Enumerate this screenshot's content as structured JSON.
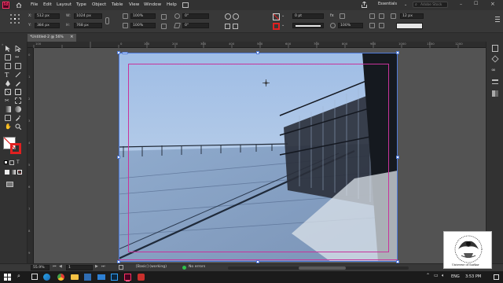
{
  "menubar": {
    "app_badge": "Id",
    "items": [
      "File",
      "Edit",
      "Layout",
      "Type",
      "Object",
      "Table",
      "View",
      "Window",
      "Help"
    ],
    "workspace": "Essentials",
    "search_placeholder": "Adobe Stock"
  },
  "control": {
    "x_label": "X:",
    "x_value": "512 px",
    "y_label": "Y:",
    "y_value": "384 px",
    "w_label": "W:",
    "w_value": "1024 px",
    "h_label": "H:",
    "h_value": "768 px",
    "scale_x": "100%",
    "scale_y": "100%",
    "rotate": "0°",
    "shear": "0°",
    "stroke_weight": "0 pt",
    "opacity": "100%",
    "ref_size": "12 px"
  },
  "tab": {
    "title": "*Untitled-2 @ 56%",
    "close": "×"
  },
  "rulers": {
    "h_ticks": [
      "100",
      "0",
      "100",
      "200",
      "300",
      "400",
      "500",
      "600",
      "700",
      "800",
      "900",
      "1000",
      "1100",
      "1200"
    ],
    "v_ticks": [
      "0",
      "1",
      "2",
      "3",
      "4",
      "5",
      "6",
      "7",
      "8",
      "9"
    ]
  },
  "status": {
    "zoom": "55.9%",
    "page": "1",
    "style": "[Basic] (working)",
    "preflight": "No errors"
  },
  "taskbar": {
    "search_icon": "search-icon",
    "lang": "ENG",
    "time": "3:53 PM"
  },
  "watermark": {
    "text": "Universe of Sarkar"
  },
  "colors": {
    "menubar_bg": "#323232",
    "panel_bg": "#383838",
    "pasteboard_bg": "#535353",
    "frame_selection": "#4f7bd9",
    "margin_guide": "#c7339b",
    "app_badge": "#ff3366"
  }
}
